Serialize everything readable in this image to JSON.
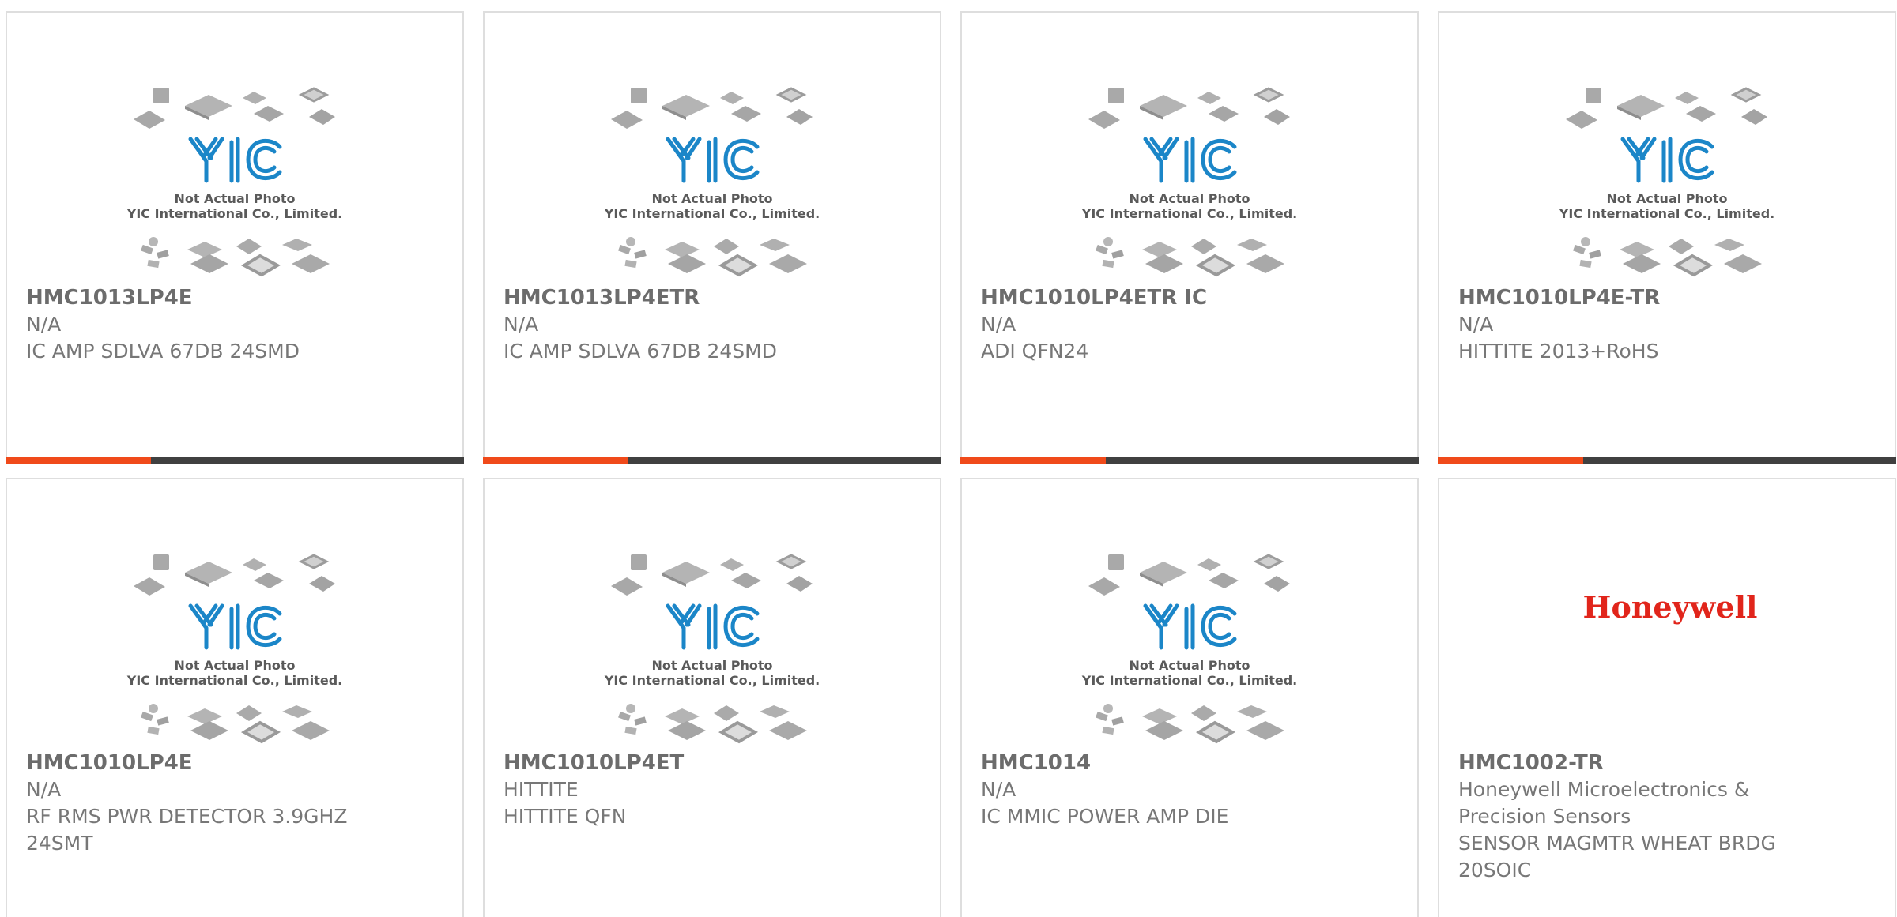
{
  "placeholder": {
    "line1": "Not Actual Photo",
    "line2": "YIC International Co., Limited.",
    "logo_text": "YIC",
    "logo_color": "#1b86c8"
  },
  "colors": {
    "accent": "#f04a1a",
    "bar_dark": "#404040",
    "text": "#777777",
    "border": "#dedede"
  },
  "products": [
    {
      "part_number": "HMC1013LP4E",
      "manufacturer": "N/A",
      "description": "IC AMP SDLVA 67DB 24SMD",
      "image": "yic-placeholder"
    },
    {
      "part_number": "HMC1013LP4ETR",
      "manufacturer": "N/A",
      "description": "IC AMP SDLVA 67DB 24SMD",
      "image": "yic-placeholder"
    },
    {
      "part_number": "HMC1010LP4ETR IC",
      "manufacturer": "N/A",
      "description": "ADI QFN24",
      "image": "yic-placeholder"
    },
    {
      "part_number": "HMC1010LP4E-TR",
      "manufacturer": "N/A",
      "description": "HITTITE 2013+RoHS",
      "image": "yic-placeholder"
    },
    {
      "part_number": "HMC1010LP4E",
      "manufacturer": "N/A",
      "description": "RF RMS PWR DETECTOR 3.9GHZ 24SMT",
      "image": "yic-placeholder"
    },
    {
      "part_number": "HMC1010LP4ET",
      "manufacturer": "HITTITE",
      "description": "HITTITE QFN",
      "image": "yic-placeholder"
    },
    {
      "part_number": "HMC1014",
      "manufacturer": "N/A",
      "description": "IC MMIC POWER AMP DIE",
      "image": "yic-placeholder"
    },
    {
      "part_number": "HMC1002-TR",
      "manufacturer": "Honeywell Microelectronics & Precision Sensors",
      "description": "SENSOR MAGMTR WHEAT BRDG 20SOIC",
      "image": "honeywell-logo",
      "brand_text": "Honeywell"
    }
  ]
}
